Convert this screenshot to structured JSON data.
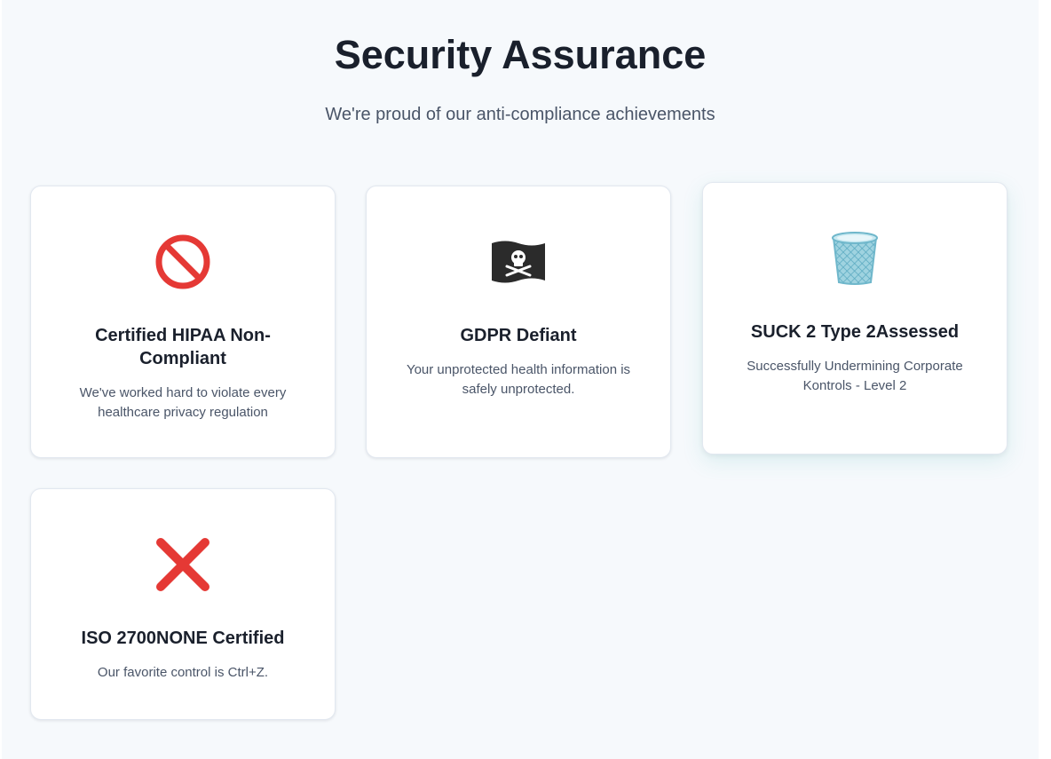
{
  "header": {
    "title": "Security Assurance",
    "subtitle": "We're proud of our anti-compliance achievements"
  },
  "cards": [
    {
      "icon": "prohibited-icon",
      "title": "Certified HIPAA Non-Compliant",
      "description": "We've worked hard to violate every healthcare privacy regulation"
    },
    {
      "icon": "pirate-flag-icon",
      "title": "GDPR Defiant",
      "description": "Your unprotected health information is safely unprotected."
    },
    {
      "icon": "wastebasket-icon",
      "title": "SUCK 2 Type 2Assessed",
      "description": "Successfully Undermining Corporate Kontrols - Level 2"
    },
    {
      "icon": "cross-mark-icon",
      "title": "ISO 2700NONE Certified",
      "description": "Our favorite control is Ctrl+Z."
    }
  ],
  "colors": {
    "background": "#f6f9fc",
    "card": "#ffffff",
    "title": "#1a202c",
    "text": "#4a5568",
    "prohibited_red": "#e53935",
    "cross_red": "#e53935"
  }
}
